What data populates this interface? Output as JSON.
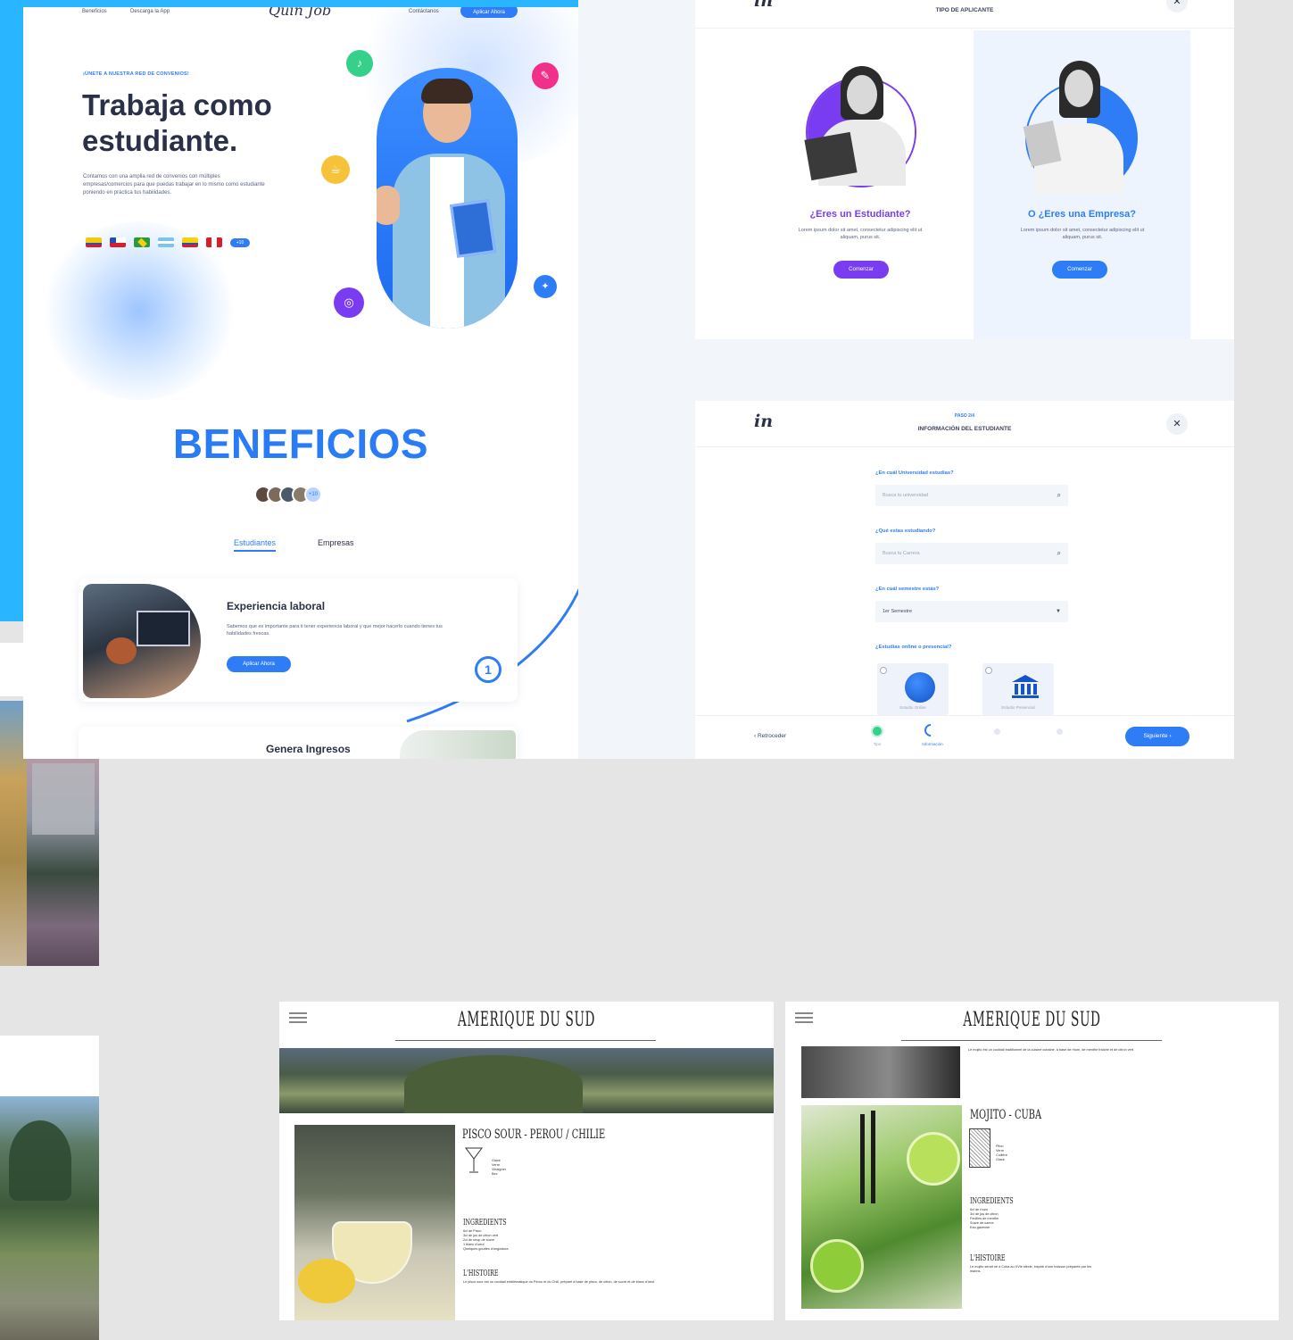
{
  "landing": {
    "nav": [
      "Beneficios",
      "Descarga la App",
      "Contáctanos"
    ],
    "logo": "Quin Job",
    "nav_button": "Aplicar Ahora",
    "eyebrow": "¡ÚNETE A NUESTRA RED DE CONVENIOS!",
    "hero_title": "Trabaja como estudiante.",
    "hero_body": "Contamos con una amplia red de convenios con múltiples empresas/comercios para que puedas trabajar en lo mismo como estudiante poniendo en práctica tus habilidades.",
    "flags_more": "+10",
    "benefits_title": "BENEFICIOS",
    "avatars_more": "+10",
    "tabs": [
      "Estudiantes",
      "Empresas"
    ],
    "card": {
      "title": "Experiencia laboral",
      "body": "Sabemos que es importante para ti tener experiencia laboral y que mejor hacerlo cuando tienes tus habilidades frescas.",
      "button": "Aplicar Ahora",
      "step": "1"
    },
    "card2_title": "Genera Ingresos",
    "colors": {
      "accent": "#2e7df7",
      "background_cyan": "#29b5ff"
    }
  },
  "applicant": {
    "title": "TIPO DE APLICANTE",
    "student": {
      "question": "¿Eres un Estudiante?",
      "body": "Lorem ipsum dolor sit amet, consectetur adipiscing elit ut aliquam, purus sit.",
      "button": "Comenzar",
      "color": "#7a3cf0"
    },
    "company": {
      "question": "O ¿Eres una Empresa?",
      "body": "Lorem ipsum dolor sit amet, consectetur adipiscing elit ut aliquam, purus sit.",
      "button": "Comenzar",
      "color": "#2e7df7"
    }
  },
  "student_form": {
    "logo": "in",
    "step": "PASO 2/4",
    "title": "INFORMACIÓN DEL ESTUDIANTE",
    "close": "✕",
    "fields": [
      {
        "label": "¿En cuál Universidad estudias?",
        "placeholder": "Busca tu universidad"
      },
      {
        "label": "¿Qué estas estudiando?",
        "placeholder": "Busca tu Carrera"
      },
      {
        "label": "¿En cuál semestre estás?",
        "value": "1er Semestre"
      },
      {
        "label": "¿Estudias online o presencial?"
      }
    ],
    "choices": [
      "Estudio Online",
      "Estudio Presencial"
    ],
    "back": "Retroceder",
    "steps": [
      "Tipo",
      "Información",
      "",
      ""
    ],
    "next": "Siguiente"
  },
  "cocktail_left": {
    "title": "AMERIQUE DU SUD",
    "heading": "PISCO SOUR - PEROU / CHILIE",
    "sketch_lines": [
      "Glace",
      "Verre",
      "Vinaigrier",
      "Bec"
    ],
    "ingredients_title": "INGREDIENTS",
    "ingredients": [
      "6cl de Pisco",
      "3cl de jus de citron vert",
      "2cl de sirop de sucre",
      "1 blanc d'oeuf",
      "Quelques gouttes d'angostura"
    ],
    "history_title": "L'HISTOIRE",
    "history": "Le pisco sour est un cocktail emblématique du Pérou et du Chili, préparé à base de pisco, de citron, de sucre et de blanc d'oeuf."
  },
  "cocktail_right": {
    "title": "AMERIQUE DU SUD",
    "intro": "Le mojito est un cocktail traditionnel de la cuisine cubaine, à base de rhum, de menthe fraîche et de citron vert.",
    "heading": "MOJITO - CUBA",
    "sketch_lines": [
      "Pilon",
      "Verre",
      "Cuillère",
      "Glace"
    ],
    "ingredients_title": "INGREDIENTS",
    "ingredients": [
      "6cl de rhum",
      "3cl de jus de citron",
      "Feuilles de menthe",
      "Sucre de canne",
      "Eau gazeuse"
    ],
    "history_title": "L'HISTOIRE",
    "history": "Le mojito serait né à Cuba au XVIe siècle, inspiré d'une boisson préparée par les marins."
  }
}
